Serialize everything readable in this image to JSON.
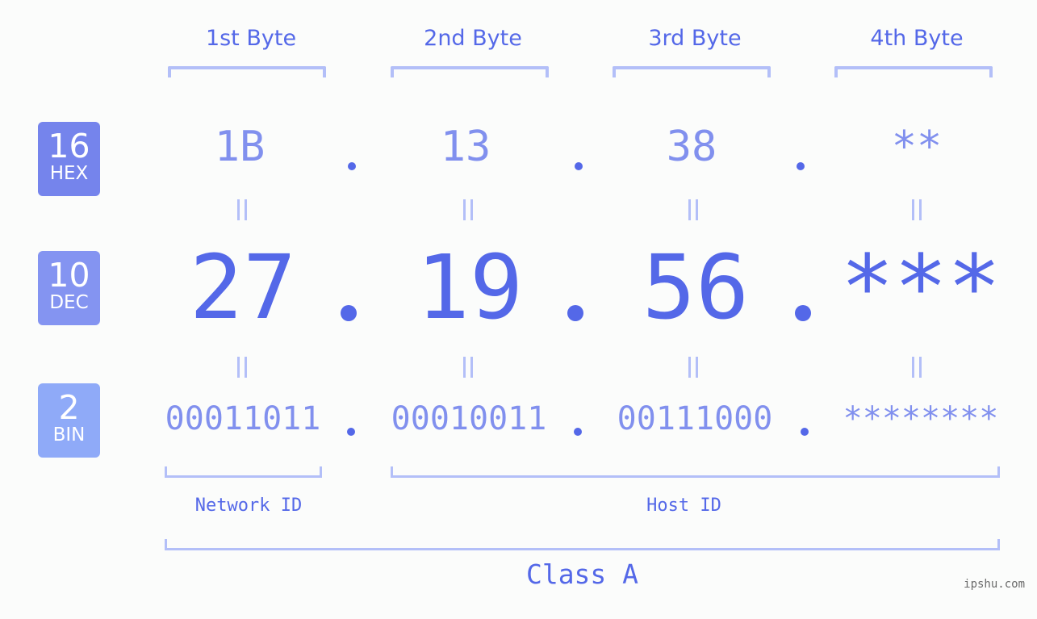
{
  "byte_labels": [
    "1st Byte",
    "2nd Byte",
    "3rd Byte",
    "4th Byte"
  ],
  "badges": {
    "hex": {
      "num": "16",
      "label": "HEX",
      "color": "#7584ec"
    },
    "dec": {
      "num": "10",
      "label": "DEC",
      "color": "#8494f1"
    },
    "bin": {
      "num": "2",
      "label": "BIN",
      "color": "#8faaf8"
    }
  },
  "hex": [
    "1B",
    "13",
    "38",
    "**"
  ],
  "dec": [
    "27",
    "19",
    "56",
    "***"
  ],
  "bin": [
    "00011011",
    "00010011",
    "00111000",
    "********"
  ],
  "separator": ".",
  "network_label": "Network ID",
  "host_label": "Host ID",
  "class_label": "Class A",
  "watermark": "ipshu.com",
  "colors": {
    "primary": "#5468e8",
    "light": "#8190ee",
    "bracket": "#b3bff8",
    "background": "#fbfcfb"
  }
}
